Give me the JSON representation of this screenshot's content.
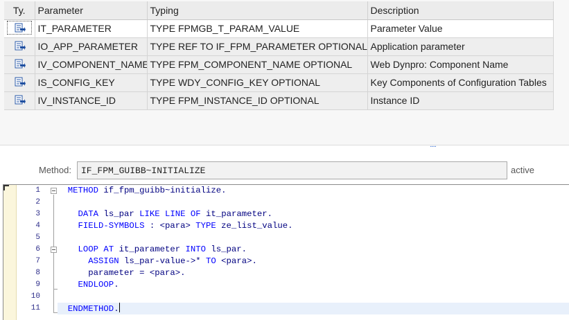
{
  "params": {
    "headers": {
      "ty": "Ty.",
      "parameter": "Parameter",
      "typing": "Typing",
      "description": "Description"
    },
    "rows": [
      {
        "icon": "importing-param-icon",
        "parameter": "IT_PARAMETER",
        "typing": "TYPE FPMGB_T_PARAM_VALUE",
        "description": "Parameter Value",
        "selected": true
      },
      {
        "icon": "importing-param-icon",
        "parameter": "IO_APP_PARAMETER",
        "typing": "TYPE REF TO IF_FPM_PARAMETER OPTIONAL",
        "description": "Application parameter"
      },
      {
        "icon": "importing-param-icon",
        "parameter": "IV_COMPONENT_NAME",
        "typing": "TYPE FPM_COMPONENT_NAME OPTIONAL",
        "description": "Web Dynpro: Component Name"
      },
      {
        "icon": "importing-param-icon",
        "parameter": "IS_CONFIG_KEY",
        "typing": "TYPE WDY_CONFIG_KEY OPTIONAL",
        "description": "Key Components of Configuration Tables"
      },
      {
        "icon": "importing-param-icon",
        "parameter": "IV_INSTANCE_ID",
        "typing": "TYPE FPM_INSTANCE_ID OPTIONAL",
        "description": "Instance ID"
      }
    ]
  },
  "splitter": {
    "grip": "....."
  },
  "method": {
    "label": "Method:",
    "value": "IF_FPM_GUIBB~INITIALIZE",
    "status": "active"
  },
  "editor": {
    "lines": [
      {
        "num": "1",
        "text": [
          [
            "kw",
            "METHOD"
          ],
          [
            "tx",
            " if_fpm_guibb~initialize."
          ]
        ]
      },
      {
        "num": "2",
        "text": []
      },
      {
        "num": "3",
        "text": [
          [
            "tx",
            "  "
          ],
          [
            "kw",
            "DATA"
          ],
          [
            "tx",
            " ls_par "
          ],
          [
            "kw",
            "LIKE LINE OF"
          ],
          [
            "tx",
            " it_parameter."
          ]
        ]
      },
      {
        "num": "4",
        "text": [
          [
            "tx",
            "  "
          ],
          [
            "kw",
            "FIELD-SYMBOLS"
          ],
          [
            "tx",
            " : <para> "
          ],
          [
            "kw",
            "TYPE"
          ],
          [
            "tx",
            " ze_list_value."
          ]
        ]
      },
      {
        "num": "5",
        "text": []
      },
      {
        "num": "6",
        "text": [
          [
            "tx",
            "  "
          ],
          [
            "kw",
            "LOOP AT"
          ],
          [
            "tx",
            " it_parameter "
          ],
          [
            "kw",
            "INTO"
          ],
          [
            "tx",
            " ls_par."
          ]
        ]
      },
      {
        "num": "7",
        "text": [
          [
            "tx",
            "    "
          ],
          [
            "kw",
            "ASSIGN"
          ],
          [
            "tx",
            " ls_par-value->* "
          ],
          [
            "kw",
            "TO"
          ],
          [
            "tx",
            " <para>."
          ]
        ]
      },
      {
        "num": "8",
        "text": [
          [
            "tx",
            "    parameter = <para>."
          ]
        ]
      },
      {
        "num": "9",
        "text": [
          [
            "tx",
            "  "
          ],
          [
            "kw",
            "ENDLOOP"
          ],
          [
            "tx",
            "."
          ]
        ]
      },
      {
        "num": "10",
        "text": []
      },
      {
        "num": "11",
        "text": [
          [
            "kw",
            "ENDMETHOD"
          ],
          [
            "tx",
            "."
          ]
        ],
        "current": true
      }
    ]
  },
  "colors": {
    "keyword": "#0000ff",
    "text": "#000080",
    "line_number": "#2d2d8a",
    "current_line": "#e8f0fb",
    "margin": "#fbf6dc"
  }
}
